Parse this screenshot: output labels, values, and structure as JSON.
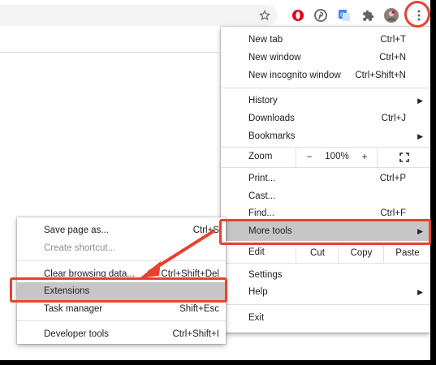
{
  "colors": {
    "annotation_red": "#e8412e",
    "highlight": "#c6c6c6",
    "opera_red": "#e0001b",
    "pinterest_red": "#c8232c",
    "translate_blue": "#4285f4"
  },
  "toolbar": {
    "icons": [
      "star-icon",
      "opera-icon",
      "pinterest-icon",
      "translate-icon",
      "extensions-puzzle-icon",
      "profile-avatar",
      "more-menu-icon"
    ]
  },
  "main_menu": {
    "new_tab": {
      "label": "New tab",
      "shortcut": "Ctrl+T"
    },
    "new_window": {
      "label": "New window",
      "shortcut": "Ctrl+N"
    },
    "new_incognito": {
      "label": "New incognito window",
      "shortcut": "Ctrl+Shift+N"
    },
    "history": {
      "label": "History"
    },
    "downloads": {
      "label": "Downloads",
      "shortcut": "Ctrl+J"
    },
    "bookmarks": {
      "label": "Bookmarks"
    },
    "zoom": {
      "label": "Zoom",
      "minus": "−",
      "value": "100%",
      "plus": "+"
    },
    "print": {
      "label": "Print...",
      "shortcut": "Ctrl+P"
    },
    "cast": {
      "label": "Cast..."
    },
    "find": {
      "label": "Find...",
      "shortcut": "Ctrl+F"
    },
    "more_tools": {
      "label": "More tools"
    },
    "edit": {
      "label": "Edit",
      "cut": "Cut",
      "copy": "Copy",
      "paste": "Paste"
    },
    "settings": {
      "label": "Settings"
    },
    "help": {
      "label": "Help"
    },
    "exit": {
      "label": "Exit"
    }
  },
  "sub_menu": {
    "save_page": {
      "label": "Save page as...",
      "shortcut": "Ctrl+S"
    },
    "create_shortcut": {
      "label": "Create shortcut..."
    },
    "clear_browsing": {
      "label": "Clear browsing data...",
      "shortcut": "Ctrl+Shift+Del"
    },
    "extensions": {
      "label": "Extensions"
    },
    "task_manager": {
      "label": "Task manager",
      "shortcut": "Shift+Esc"
    },
    "developer_tools": {
      "label": "Developer tools",
      "shortcut": "Ctrl+Shift+I"
    }
  }
}
